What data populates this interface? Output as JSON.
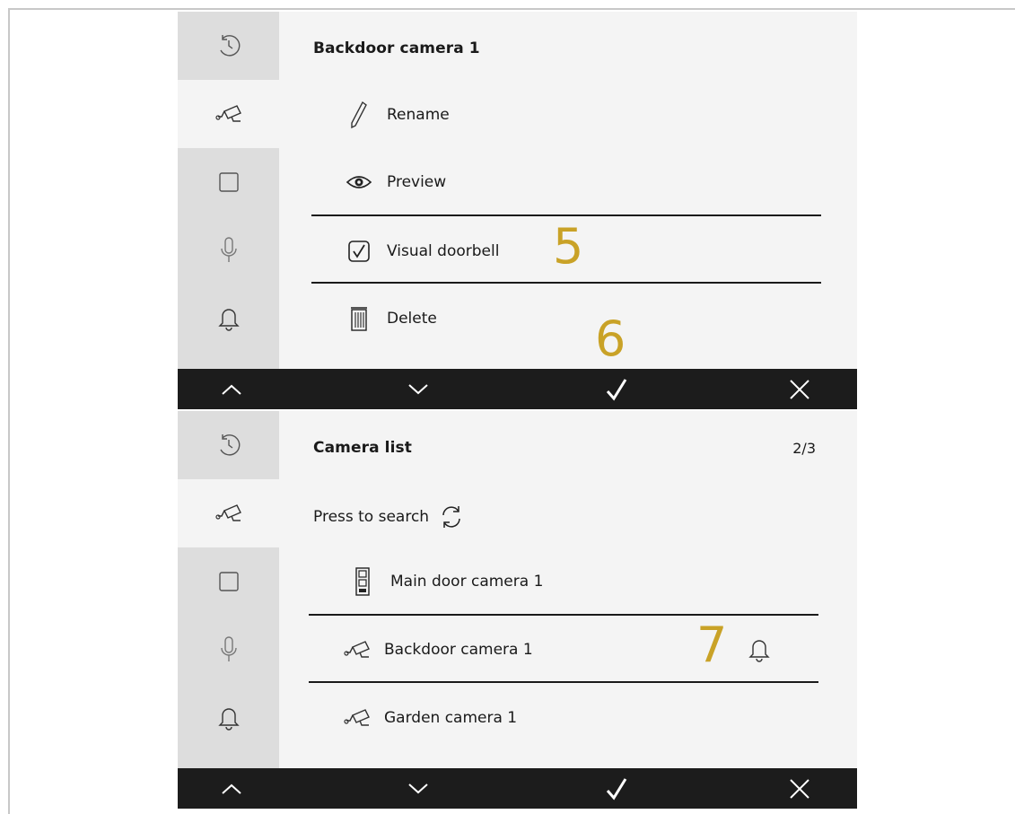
{
  "sidebar_icons": [
    "history-icon",
    "camera-icon",
    "square-icon",
    "microphone-icon",
    "bell-icon"
  ],
  "panel_top": {
    "title": "Backdoor camera 1",
    "menu": [
      {
        "icon": "pencil-icon",
        "label": "Rename"
      },
      {
        "icon": "eye-icon",
        "label": "Preview"
      },
      {
        "icon": "checkbox-checked-icon",
        "label": "Visual doorbell"
      },
      {
        "icon": "trash-icon",
        "label": "Delete"
      }
    ],
    "annotations": [
      "5",
      "6"
    ]
  },
  "panel_bottom": {
    "title": "Camera list",
    "page_indicator": "2/3",
    "search_label": "Press to search",
    "cameras": [
      {
        "icon": "door-station-icon",
        "label": "Main door camera 1"
      },
      {
        "icon": "camera-icon",
        "label": "Backdoor camera 1",
        "trailing_icon": "bell-icon"
      },
      {
        "icon": "camera-icon",
        "label": "Garden camera 1"
      }
    ],
    "annotations": [
      "7"
    ]
  },
  "bottombar": [
    "chevron-up-icon",
    "chevron-down-icon",
    "checkmark-icon",
    "close-icon"
  ],
  "colors": {
    "annotation": "#c9a227",
    "sidebar": "#dddddd",
    "panel": "#f4f4f4",
    "bottombar": "#1c1c1c"
  }
}
